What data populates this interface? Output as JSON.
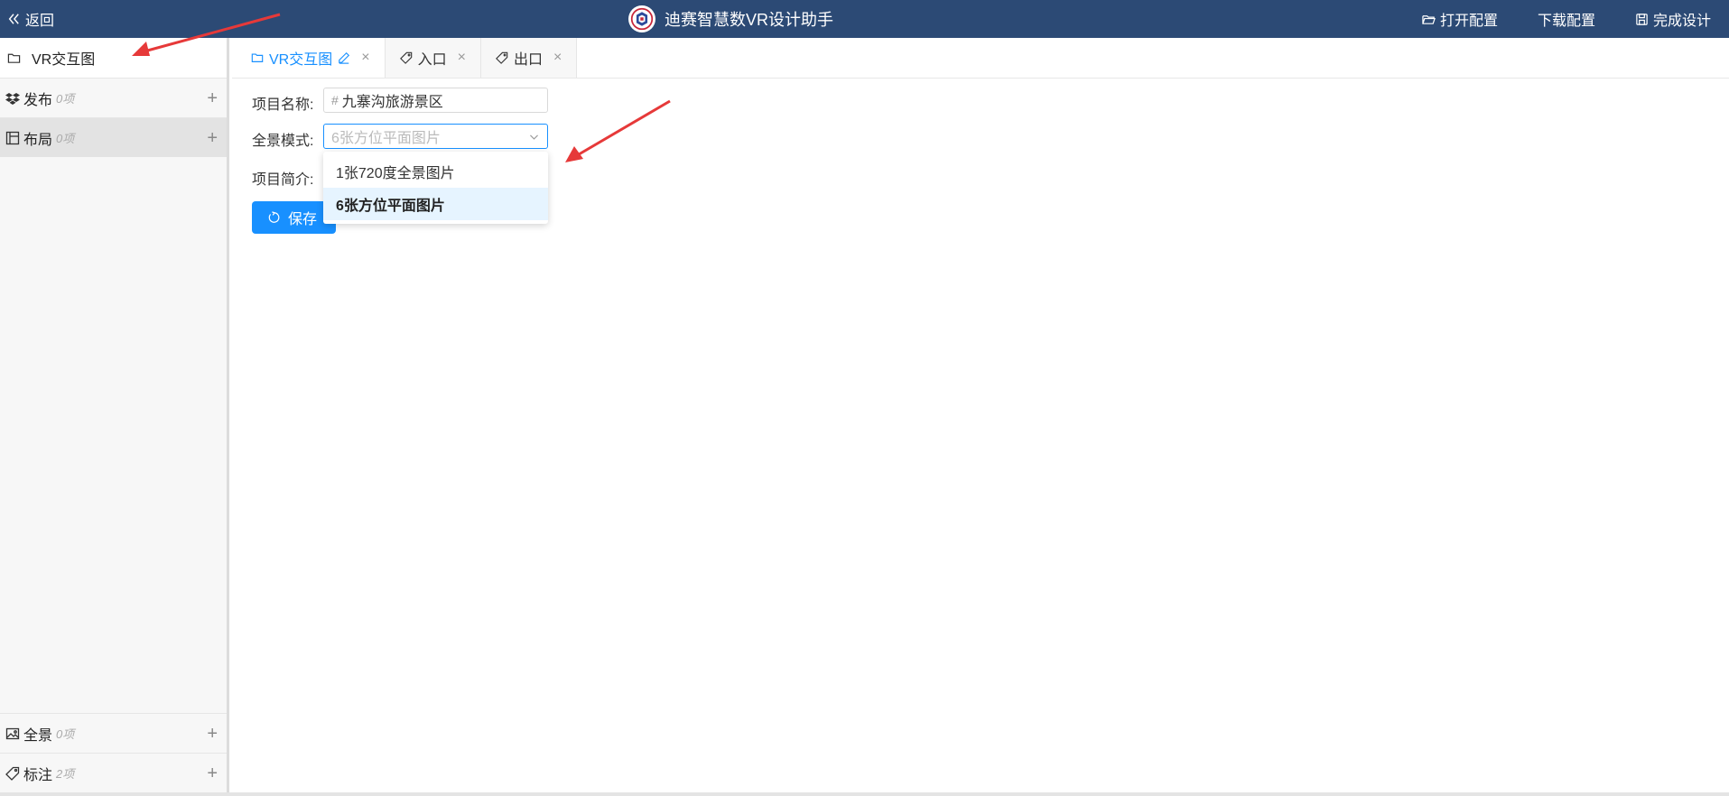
{
  "header": {
    "back_label": "返回",
    "title": "迪赛智慧数VR设计助手",
    "actions": {
      "open": "打开配置",
      "download": "下载配置",
      "finish": "完成设计"
    }
  },
  "sidebar": {
    "root_label": "VR交互图",
    "items": [
      {
        "label": "发布",
        "count": "0项"
      },
      {
        "label": "布局",
        "count": "0项"
      },
      {
        "label": "全景",
        "count": "0项"
      },
      {
        "label": "标注",
        "count": "2项"
      }
    ]
  },
  "tabs": [
    {
      "label": "VR交互图"
    },
    {
      "label": "入口"
    },
    {
      "label": "出口"
    }
  ],
  "form": {
    "name_label": "项目名称:",
    "name_value": "九寨沟旅游景区",
    "mode_label": "全景模式:",
    "mode_placeholder": "6张方位平面图片",
    "intro_label": "项目简介:",
    "options": [
      "1张720度全景图片",
      "6张方位平面图片"
    ],
    "save_label": "保存"
  },
  "colors": {
    "header": "#2c4a75",
    "accent": "#1890ff",
    "annotation": "#e63939"
  }
}
